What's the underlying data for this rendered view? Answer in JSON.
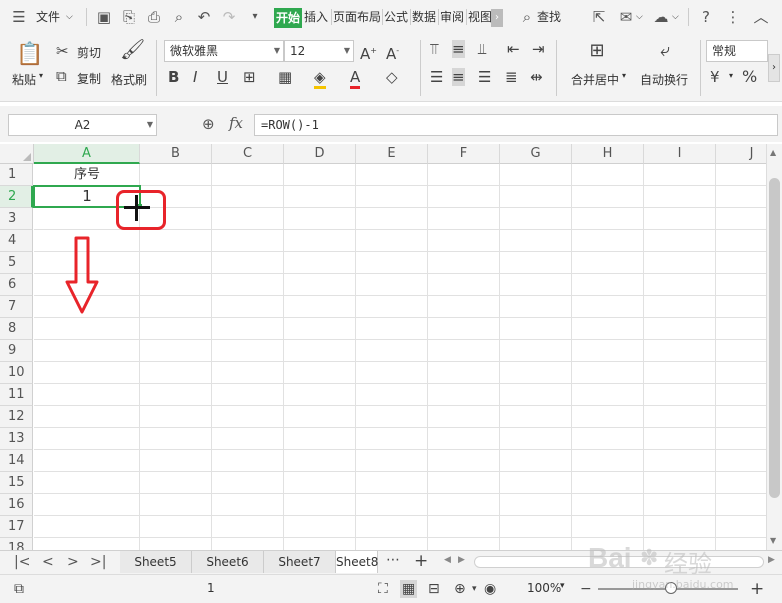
{
  "menu": {
    "file_label": "文件",
    "tabs": [
      "开始",
      "插入",
      "页面布局",
      "公式",
      "数据",
      "审阅",
      "视图"
    ],
    "search_label": "查找"
  },
  "ribbon": {
    "paste": "粘贴",
    "cut": "剪切",
    "copy": "复制",
    "format_painter": "格式刷",
    "font_name": "微软雅黑",
    "font_size": "12",
    "merge_center": "合并居中",
    "wrap_text": "自动换行",
    "number_format": "常规",
    "percent": "%"
  },
  "formula_bar": {
    "name_box": "A2",
    "fx": "fx",
    "formula": "=ROW()-1"
  },
  "grid": {
    "columns": [
      "A",
      "B",
      "C",
      "D",
      "E",
      "F",
      "G",
      "H",
      "I",
      "J"
    ],
    "rows": [
      "1",
      "2",
      "3",
      "4",
      "5",
      "6",
      "7",
      "8",
      "9",
      "10",
      "11",
      "12",
      "13",
      "14",
      "15",
      "16",
      "17",
      "18"
    ],
    "cells": {
      "A1": "序号",
      "A2": "1"
    }
  },
  "sheets": [
    "Sheet5",
    "Sheet6",
    "Sheet7",
    "Sheet8"
  ],
  "status": {
    "count": "1",
    "zoom": "100%"
  },
  "colors": {
    "accent": "#2fa84f",
    "annotation": "#e8242a"
  },
  "watermark": {
    "text1": "Bai",
    "text2": "经验",
    "sub": "jingyan.baidu.com"
  }
}
